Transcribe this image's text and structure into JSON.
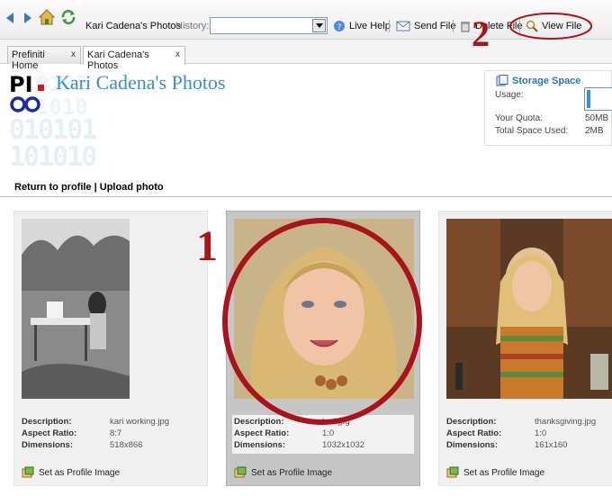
{
  "toolbar": {
    "site_label": "Kari Cadena's Photos",
    "history_label": "History:",
    "history_value": "",
    "live_help": "Live Help",
    "send_file": "Send File",
    "delete_file": "Delete File",
    "view_file": "View File"
  },
  "tabs": [
    {
      "label": "Prefiniti Home",
      "close": "x"
    },
    {
      "label": "Kari Cadena's Photos",
      "close": "x"
    }
  ],
  "header": {
    "title": "Kari Cadena's Photos",
    "logo_text": "PI.",
    "links": {
      "return": "Return to profile",
      "separator": " | ",
      "upload": "Upload photo"
    }
  },
  "storage": {
    "title": "Storage Space",
    "usage_label": "Usage:",
    "usage_fraction": 0.04,
    "quota_label": "Your Quota:",
    "quota_value": "50MB",
    "used_label": "Total Space Used:",
    "used_value": "2MB"
  },
  "photos": [
    {
      "description_label": "Description:",
      "description": "kari working.jpg",
      "aspect_label": "Aspect Ratio:",
      "aspect": "8:7",
      "dims_label": "Dimensions:",
      "dims": "518x866",
      "action": "Set as Profile Image"
    },
    {
      "description_label": "Description:",
      "description": "kari.jpg",
      "aspect_label": "Aspect Ratio:",
      "aspect": "1:0",
      "dims_label": "Dimensions:",
      "dims": "1032x1032",
      "action": "Set as Profile Image"
    },
    {
      "description_label": "Description:",
      "description": "thanksgiving.jpg",
      "aspect_label": "Aspect Ratio:",
      "aspect": "1:0",
      "dims_label": "Dimensions:",
      "dims": "161x160",
      "action": "Set as Profile Image"
    }
  ],
  "annotations": {
    "one": "1",
    "two": "2"
  },
  "colors": {
    "accent": "#3a8fc4",
    "annotation": "#a8141c",
    "selected_card": "#c6c6c6"
  }
}
